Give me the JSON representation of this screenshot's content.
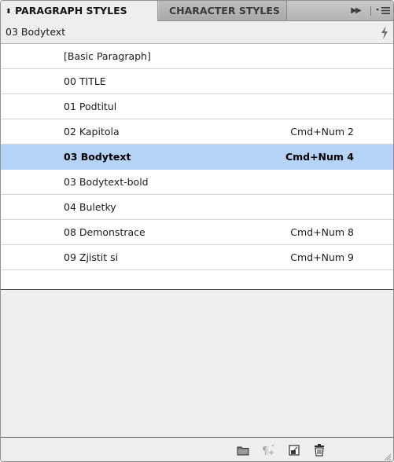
{
  "tabs": {
    "paragraph_styles": "PARAGRAPH STYLES",
    "character_styles": "CHARACTER STYLES",
    "sort_glyph": "⬍",
    "collapse_glyph": "▶▶"
  },
  "header": {
    "current_style": "03 Bodytext"
  },
  "styles": [
    {
      "name": "[Basic Paragraph]",
      "shortcut": "",
      "selected": false
    },
    {
      "name": "00 TITLE",
      "shortcut": "",
      "selected": false
    },
    {
      "name": "01 Podtitul",
      "shortcut": "",
      "selected": false
    },
    {
      "name": "02 Kapitola",
      "shortcut": "Cmd+Num 2",
      "selected": false
    },
    {
      "name": "03 Bodytext",
      "shortcut": "Cmd+Num 4",
      "selected": true
    },
    {
      "name": "03 Bodytext-bold",
      "shortcut": "",
      "selected": false
    },
    {
      "name": "04 Buletky",
      "shortcut": "",
      "selected": false
    },
    {
      "name": "08 Demonstrace",
      "shortcut": "Cmd+Num 8",
      "selected": false
    },
    {
      "name": "09 Zjistit si",
      "shortcut": "Cmd+Num 9",
      "selected": false
    }
  ],
  "colors": {
    "selection": "#b5d3f7",
    "panel_bg": "#eeeeee",
    "row_divider": "#d3d3d3"
  },
  "icons": {
    "header": "lightning-icon",
    "footer": [
      "new-style-group-icon",
      "clear-overrides-icon",
      "create-new-style-icon",
      "delete-style-icon"
    ]
  }
}
